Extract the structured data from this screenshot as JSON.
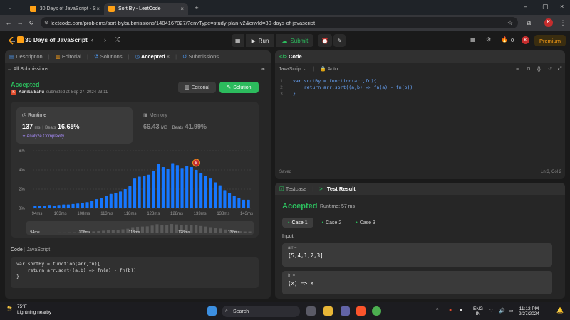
{
  "browser": {
    "tabs": [
      {
        "title": "30 Days of JavaScript - Study P",
        "active": false
      },
      {
        "title": "Sort By - LeetCode",
        "active": true
      }
    ],
    "url": "leetcode.com/problems/sort-by/submissions/1404167827/?envType=study-plan-v2&envId=30-days-of-javascript",
    "avatar_letter": "K"
  },
  "header": {
    "study_plan": "30 Days of JavaScript",
    "run_label": "Run",
    "submit_label": "Submit",
    "streak": "0",
    "avatar_letter": "K",
    "premium_label": "Premium"
  },
  "left": {
    "tabs": [
      "Description",
      "Editorial",
      "Solutions",
      "Accepted",
      "Submissions"
    ],
    "back_label": "All Submissions",
    "status": "Accepted",
    "user": "Kanika Sahu",
    "submitted_text": "submitted at Sep 27, 2024 23:11",
    "editorial_btn": "Editorial",
    "solution_btn": "Solution",
    "runtime": {
      "label": "Runtime",
      "value": "137",
      "unit": "ms",
      "beats_label": "Beats",
      "beats": "16.65%",
      "analyze": "Analyze Complexity"
    },
    "memory": {
      "label": "Memory",
      "value": "66.43",
      "unit": "MB",
      "beats_label": "Beats",
      "beats": "41.99%"
    },
    "code_label": "Code",
    "code_lang": "JavaScript",
    "code_lines": [
      "var sortBy = function(arr,fn){",
      "    return arr.sort((a,b) => fn(a) - fn(b))",
      "}"
    ]
  },
  "chart_data": {
    "type": "bar",
    "ylabels": [
      "6%",
      "4%",
      "2%",
      "0%"
    ],
    "ylim": [
      0,
      6
    ],
    "xlabels": [
      "94ms",
      "103ms",
      "108ms",
      "113ms",
      "118ms",
      "123ms",
      "128ms",
      "133ms",
      "138ms",
      "143ms"
    ],
    "values": [
      0.3,
      0.25,
      0.3,
      0.35,
      0.3,
      0.35,
      0.4,
      0.4,
      0.45,
      0.5,
      0.55,
      0.65,
      0.8,
      0.95,
      1.1,
      1.3,
      1.5,
      1.6,
      1.75,
      2.0,
      2.3,
      3.1,
      3.3,
      3.4,
      3.5,
      3.9,
      4.6,
      4.3,
      4.1,
      4.7,
      4.5,
      4.2,
      4.4,
      4.3,
      4.0,
      3.7,
      3.4,
      3.1,
      2.7,
      2.4,
      1.9,
      1.6,
      1.3,
      1.05,
      0.9,
      0.9
    ],
    "highlight_index": 34,
    "mini_labels": [
      "94ms",
      "108ms",
      "118ms",
      "128ms",
      "138ms"
    ]
  },
  "right": {
    "code_tab": "Code",
    "language": "JavaScript",
    "mode": "Auto",
    "editor_lines": [
      "var sortBy = function(arr,fn){",
      "    return arr.sort((a,b) => fn(a) - fn(b))",
      "}"
    ],
    "saved": "Saved",
    "cursor": "Ln 3, Col 2",
    "testcase_tab": "Testcase",
    "result_tab": "Test Result",
    "result_status": "Accepted",
    "runtime": "Runtime: 57 ms",
    "cases": [
      "Case 1",
      "Case 2",
      "Case 3"
    ],
    "input_label": "Input",
    "inputs": [
      {
        "name": "arr =",
        "value": "[5,4,1,2,3]"
      },
      {
        "name": "fn =",
        "value": "(x) => x"
      }
    ]
  },
  "taskbar": {
    "temperature": "75°F",
    "weather": "Lightning nearby",
    "search": "Search",
    "lang": "ENG",
    "region": "IN",
    "time": "11:12 PM",
    "date": "9/27/2024"
  },
  "colors": {
    "accent_green": "#2cbb5d",
    "brand_orange": "#ffa116",
    "bar_blue": "#1677ff"
  }
}
